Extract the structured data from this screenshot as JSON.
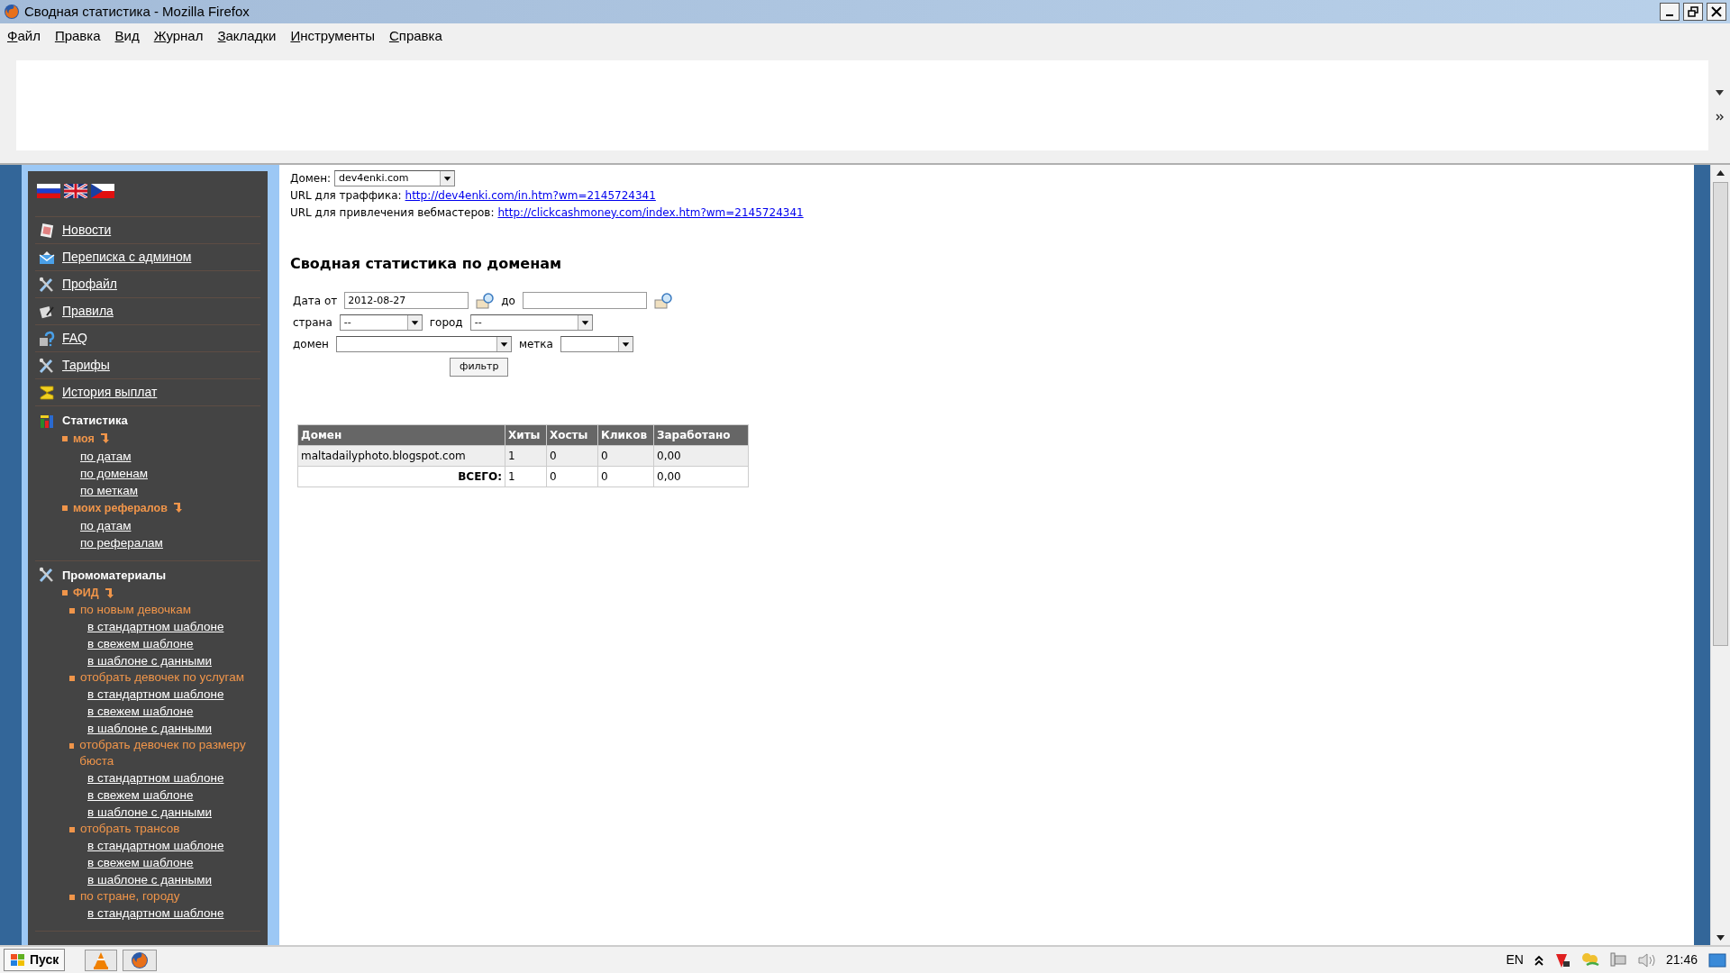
{
  "window": {
    "title": "Сводная статистика - Mozilla Firefox"
  },
  "menu": [
    {
      "label": "Файл"
    },
    {
      "label": "Правка"
    },
    {
      "label": "Вид"
    },
    {
      "label": "Журнал"
    },
    {
      "label": "Закладки"
    },
    {
      "label": "Инструменты"
    },
    {
      "label": "Справка"
    }
  ],
  "sidebar": {
    "nav": [
      {
        "label": "Новости"
      },
      {
        "label": "Переписка с админом"
      },
      {
        "label": "Профайл"
      },
      {
        "label": "Правила"
      },
      {
        "label": "FAQ"
      },
      {
        "label": "Тарифы"
      },
      {
        "label": "История выплат"
      }
    ],
    "sections": [
      {
        "title": "Статистика",
        "groups": [
          {
            "label": "моя",
            "links": [
              "по датам",
              "по доменам",
              "по меткам"
            ]
          },
          {
            "label": "моих рефералов",
            "links": [
              "по датам",
              "по рефералам"
            ]
          }
        ]
      },
      {
        "title": "Промоматериалы",
        "groups": [
          {
            "label": "ФИД",
            "subgroups": [
              {
                "label": "по новым девочкам",
                "links": [
                  "в стандартном шаблоне",
                  "в свежем шаблоне",
                  "в шаблоне с данными"
                ]
              },
              {
                "label": "отобрать девочек по услугам",
                "links": [
                  "в стандартном шаблоне",
                  "в свежем шаблоне",
                  "в шаблоне с данными"
                ]
              },
              {
                "label": "отобрать девочек по размеру бюста",
                "links": [
                  "в стандартном шаблоне",
                  "в свежем шаблоне",
                  "в шаблоне с данными"
                ]
              },
              {
                "label": "отобрать трансов",
                "links": [
                  "в стандартном шаблоне",
                  "в свежем шаблоне",
                  "в шаблоне с данными"
                ]
              },
              {
                "label": "по стране, городу",
                "links": [
                  "в стандартном шаблоне"
                ]
              }
            ]
          }
        ]
      }
    ]
  },
  "main": {
    "domain": {
      "label": "Домен:",
      "value": "dev4enki.com"
    },
    "urls": [
      {
        "label": "URL для траффика:",
        "link": "http://dev4enki.com/in.htm?wm=2145724341"
      },
      {
        "label": "URL для привлечения вебмастеров:",
        "link": "http://clickcashmoney.com/index.htm?wm=2145724341"
      }
    ],
    "heading": "Сводная статистика по доменам",
    "filters": {
      "date_from": {
        "label": "Дата от",
        "value": "2012-08-27"
      },
      "date_to": {
        "label": "до"
      },
      "country": {
        "label": "страна",
        "value": "--"
      },
      "city": {
        "label": "город",
        "value": "--"
      },
      "domain": {
        "label": "домен"
      },
      "tag": {
        "label": "метка"
      },
      "button": "фильтр"
    },
    "table": {
      "columns": [
        "Домен",
        "Хиты",
        "Хосты",
        "Кликов",
        "Заработано"
      ],
      "rows": [
        [
          "maltadailyphoto.blogspot.com",
          "1",
          "0",
          "0",
          "0,00"
        ]
      ],
      "total": {
        "label": "ВСЕГО:",
        "values": [
          "1",
          "0",
          "0",
          "0,00"
        ]
      }
    }
  },
  "taskbar": {
    "start": "Пуск",
    "language": "EN",
    "time": "21:46"
  }
}
